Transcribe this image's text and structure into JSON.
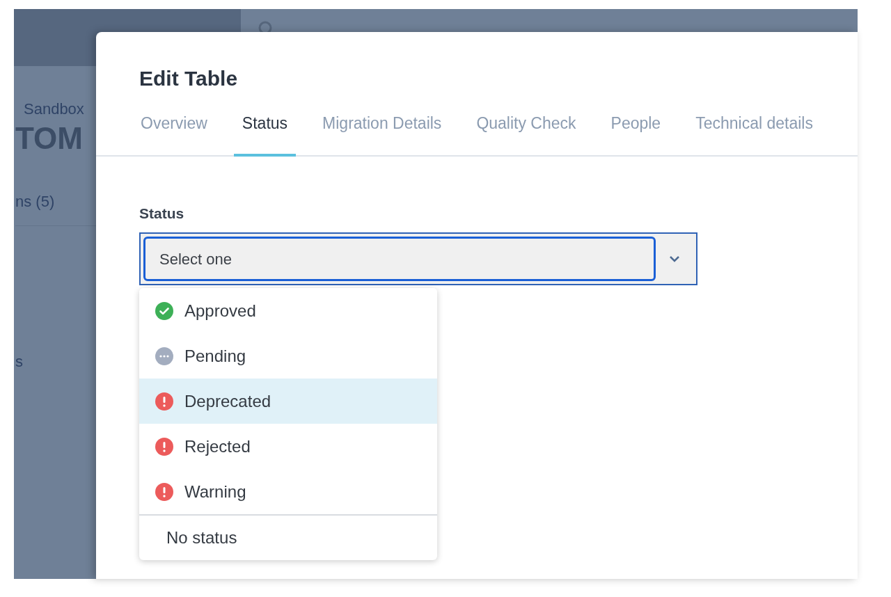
{
  "background": {
    "breadcrumb": "Sandbox",
    "heading": "TOM",
    "tab": "ns (5)",
    "side_text": "s"
  },
  "dialog": {
    "title": "Edit Table",
    "tabs": [
      {
        "label": "Overview",
        "selected": false
      },
      {
        "label": "Status",
        "selected": true
      },
      {
        "label": "Migration Details",
        "selected": false
      },
      {
        "label": "Quality Check",
        "selected": false
      },
      {
        "label": "People",
        "selected": false
      },
      {
        "label": "Technical details",
        "selected": false
      }
    ],
    "field_label": "Status",
    "select": {
      "placeholder": "Select one",
      "expanded": true
    },
    "options": [
      {
        "label": "Approved",
        "kind": "approved",
        "highlighted": false
      },
      {
        "label": "Pending",
        "kind": "pending",
        "highlighted": false
      },
      {
        "label": "Deprecated",
        "kind": "alert",
        "highlighted": true
      },
      {
        "label": "Rejected",
        "kind": "alert",
        "highlighted": false
      },
      {
        "label": "Warning",
        "kind": "alert",
        "highlighted": false
      }
    ],
    "clear_option": "No status"
  }
}
